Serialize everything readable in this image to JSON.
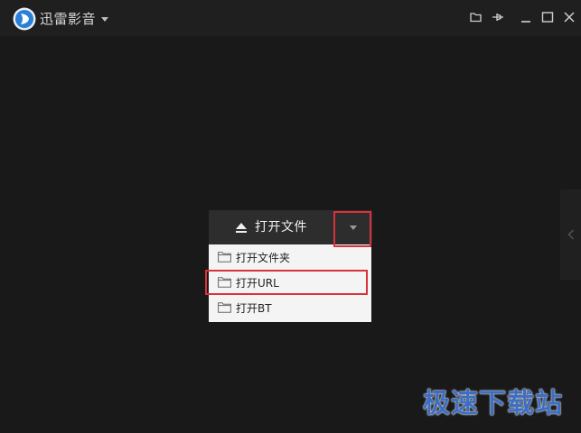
{
  "app": {
    "title": "迅雷影音"
  },
  "titlebar": {
    "icons": [
      "open-folder-icon",
      "pin-icon",
      "minimize-icon",
      "maximize-icon",
      "close-icon"
    ]
  },
  "open_panel": {
    "open_file_label": "打开文件",
    "menu": [
      {
        "label": "打开文件夹",
        "icon": "folder-icon"
      },
      {
        "label": "打开URL",
        "icon": "folder-icon"
      },
      {
        "label": "打开BT",
        "icon": "folder-icon"
      }
    ]
  },
  "colors": {
    "background": "#191919",
    "highlight": "#d9323a",
    "watermark": "#3e6ec2"
  },
  "watermark": {
    "text": "极速下载站"
  }
}
